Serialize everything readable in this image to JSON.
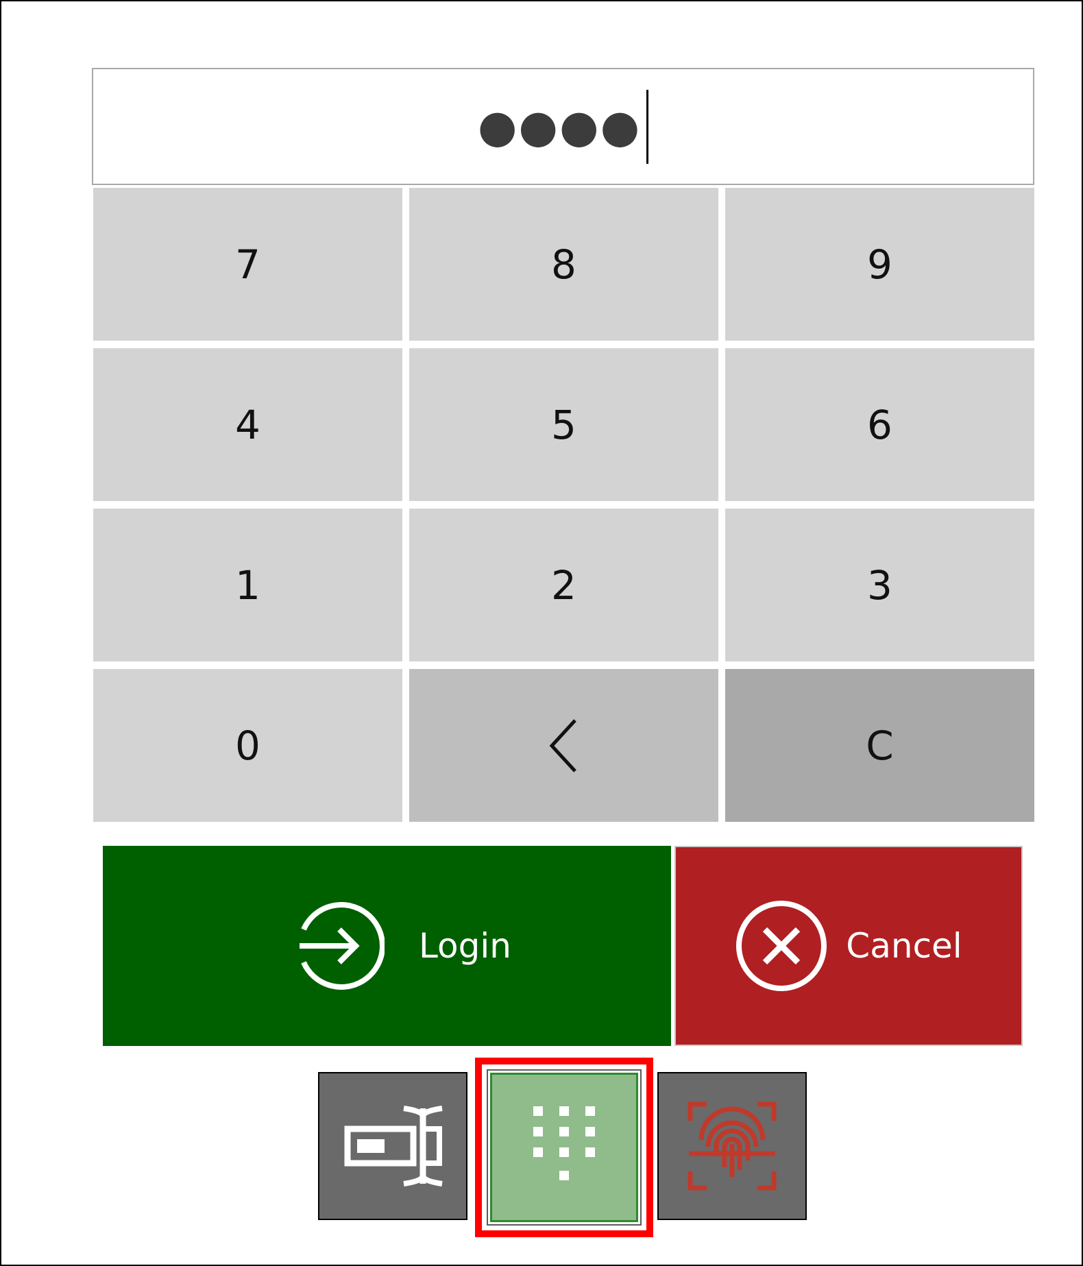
{
  "pin": {
    "masked_value": "●●●●"
  },
  "keypad": {
    "keys": [
      "7",
      "8",
      "9",
      "4",
      "5",
      "6",
      "1",
      "2",
      "3",
      "0"
    ],
    "clear_label": "C"
  },
  "actions": {
    "login_label": "Login",
    "cancel_label": "Cancel"
  },
  "modes": {
    "selected": "pin-pad"
  },
  "colors": {
    "login": "#006000",
    "cancel": "#b01f22",
    "selected_mode": "#8fbc8a",
    "selection_highlight": "#ff0000",
    "fingerprint": "#c0392b"
  }
}
